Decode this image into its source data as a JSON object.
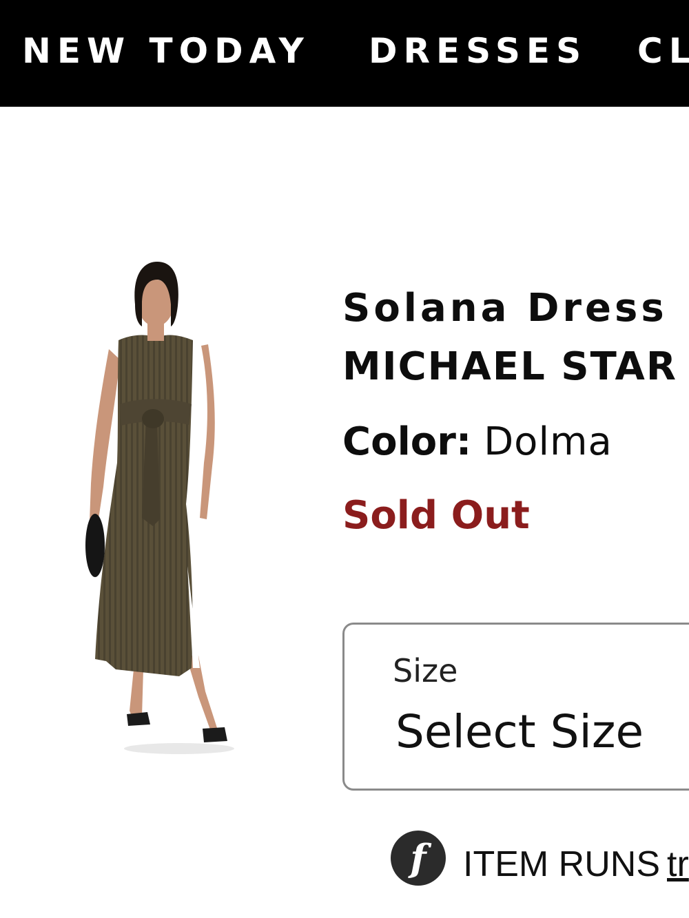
{
  "nav": {
    "items": [
      {
        "label": "NEW TODAY"
      },
      {
        "label": "DRESSES"
      },
      {
        "label": "CL"
      }
    ]
  },
  "product": {
    "image_alt": "model wearing olive ribbed sleeveless tie-waist maxi dress",
    "title": "Solana Dress",
    "brand": "MICHAEL STAR",
    "color_label": "Color:",
    "color_value": "Dolma",
    "availability": "Sold Out",
    "availability_color": "#8b1d1d"
  },
  "size_selector": {
    "label": "Size",
    "value": "Select Size"
  },
  "fit": {
    "icon": "fit-predictor-icon",
    "icon_glyph": "f",
    "text": "ITEM RUNS",
    "link_text": "tr"
  }
}
